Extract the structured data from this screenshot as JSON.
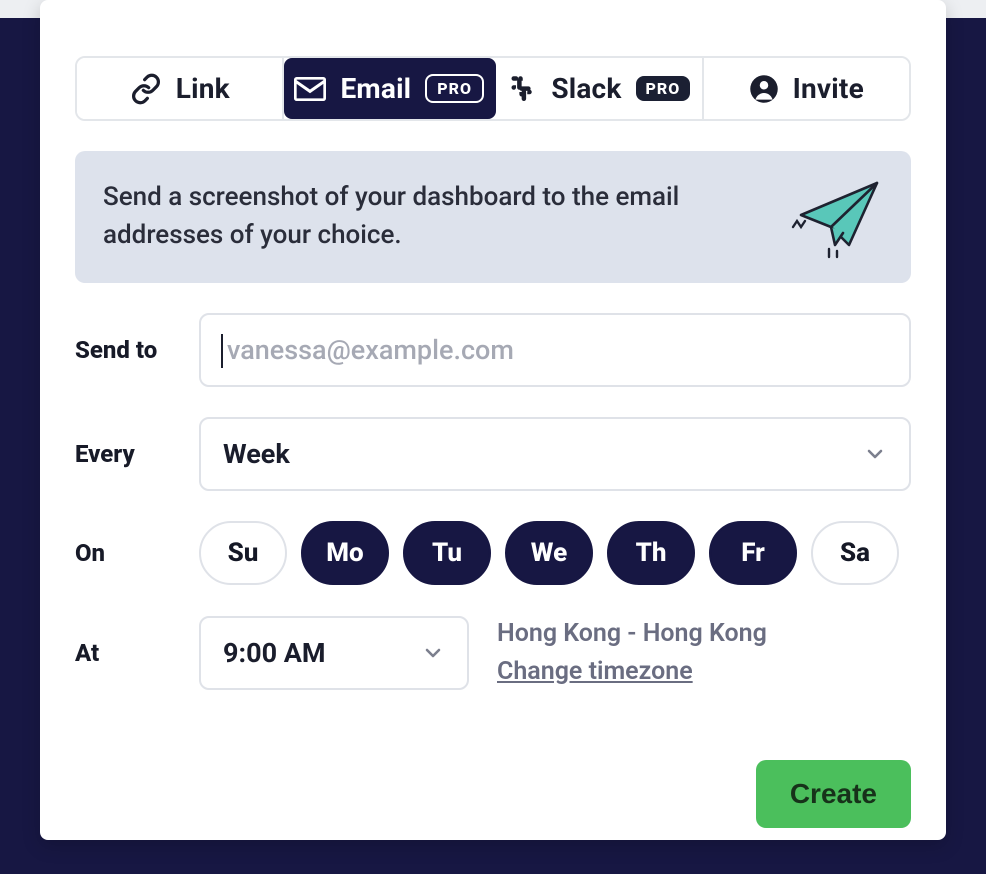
{
  "tabs": {
    "link": {
      "label": "Link"
    },
    "email": {
      "label": "Email",
      "badge": "PRO"
    },
    "slack": {
      "label": "Slack",
      "badge": "PRO"
    },
    "invite": {
      "label": "Invite"
    },
    "active": "email"
  },
  "banner": {
    "text": "Send a screenshot of your dashboard to the email addresses of your choice."
  },
  "form": {
    "send_to": {
      "label": "Send to",
      "placeholder": "vanessa@example.com",
      "value": ""
    },
    "every": {
      "label": "Every",
      "value": "Week"
    },
    "on": {
      "label": "On",
      "days": [
        {
          "abbr": "Su",
          "selected": false
        },
        {
          "abbr": "Mo",
          "selected": true
        },
        {
          "abbr": "Tu",
          "selected": true
        },
        {
          "abbr": "We",
          "selected": true
        },
        {
          "abbr": "Th",
          "selected": true
        },
        {
          "abbr": "Fr",
          "selected": true
        },
        {
          "abbr": "Sa",
          "selected": false
        }
      ]
    },
    "at": {
      "label": "At",
      "time": "9:00 AM",
      "timezone": "Hong Kong - Hong Kong",
      "change_text": "Change timezone"
    }
  },
  "actions": {
    "create": "Create"
  }
}
